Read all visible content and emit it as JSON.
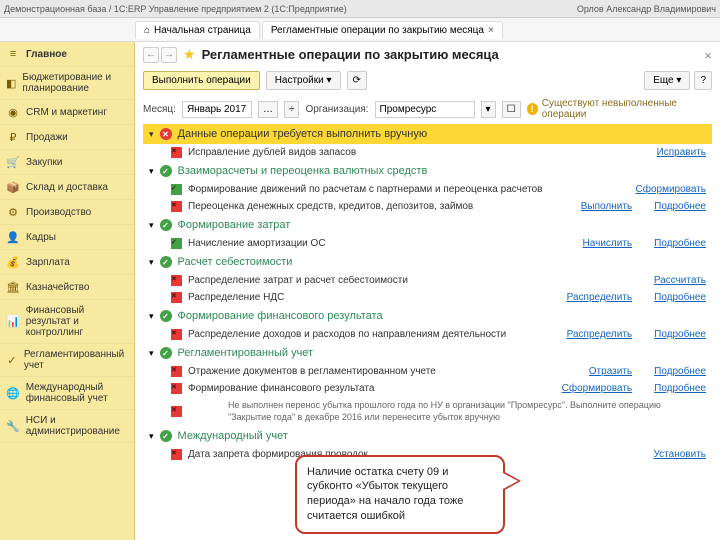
{
  "topbar": {
    "left": "Демонстрационная база / 1С:ERP Управление предприятием 2 (1С:Предприятие)",
    "right": "Орлов Александр Владимирович"
  },
  "tabs": {
    "home": "Начальная страница",
    "current": "Регламентные операции по закрытию месяца"
  },
  "sidebar": {
    "items": [
      {
        "icon": "≡",
        "label": "Главное"
      },
      {
        "icon": "◧",
        "label": "Бюджетирование и планирование"
      },
      {
        "icon": "◉",
        "label": "CRM и маркетинг"
      },
      {
        "icon": "₽",
        "label": "Продажи"
      },
      {
        "icon": "🛒",
        "label": "Закупки"
      },
      {
        "icon": "📦",
        "label": "Склад и доставка"
      },
      {
        "icon": "⚙",
        "label": "Производство"
      },
      {
        "icon": "👤",
        "label": "Кадры"
      },
      {
        "icon": "💰",
        "label": "Зарплата"
      },
      {
        "icon": "🏛",
        "label": "Казначейство"
      },
      {
        "icon": "📊",
        "label": "Финансовый результат и контроллинг"
      },
      {
        "icon": "✓",
        "label": "Регламентированный учет"
      },
      {
        "icon": "🌐",
        "label": "Международный финансовый учет"
      },
      {
        "icon": "🔧",
        "label": "НСИ и администрирование"
      }
    ]
  },
  "page": {
    "title": "Регламентные операции по закрытию месяца",
    "btn_exec": "Выполнить операции",
    "btn_settings": "Настройки",
    "btn_more": "Еще",
    "filter": {
      "month_label": "Месяц:",
      "month_value": "Январь 2017",
      "org_label": "Организация:",
      "org_value": "Промресурс"
    },
    "warning": "Существуют невыполненные операции"
  },
  "sections": [
    {
      "status": "red",
      "yellow": true,
      "title": "Данные операции требуется выполнить вручную",
      "ops": [
        {
          "status": "red",
          "label": "Исправление дублей видов запасов",
          "links": [
            "Исправить"
          ]
        }
      ]
    },
    {
      "status": "green",
      "title": "Взаиморасчеты и переоценка валютных средств",
      "ops": [
        {
          "status": "green",
          "label": "Формирование движений по расчетам с партнерами и переоценка расчетов",
          "links": [
            "Сформировать"
          ]
        },
        {
          "status": "red",
          "label": "Переоценка денежных средств, кредитов, депозитов, займов",
          "links": [
            "Выполнить",
            "Подробнее"
          ]
        }
      ]
    },
    {
      "status": "green",
      "title": "Формирование затрат",
      "ops": [
        {
          "status": "green",
          "label": "Начисление амортизации ОС",
          "links": [
            "Начислить",
            "Подробнее"
          ]
        }
      ]
    },
    {
      "status": "green",
      "title": "Расчет себестоимости",
      "ops": [
        {
          "status": "red",
          "label": "Распределение затрат и расчет себестоимости",
          "links": [
            "Рассчитать"
          ]
        },
        {
          "status": "red",
          "label": "Распределение НДС",
          "links": [
            "Распределить",
            "Подробнее"
          ]
        }
      ]
    },
    {
      "status": "green",
      "title": "Формирование финансового результата",
      "ops": [
        {
          "status": "red",
          "label": "Распределение доходов и расходов по направлениям деятельности",
          "links": [
            "Распределить",
            "Подробнее"
          ]
        }
      ]
    },
    {
      "status": "green",
      "title": "Регламентированный учет",
      "ops": [
        {
          "status": "red",
          "label": "Отражение документов в регламентированном учете",
          "links": [
            "Отразить",
            "Подробнее"
          ]
        },
        {
          "status": "red",
          "label": "Формирование финансового результата",
          "links": [
            "Сформировать",
            "Подробнее"
          ],
          "note": "Не выполнен перенос убытка прошлого года по НУ в организации \"Промресурс\". Выполните операцию \"Закрытие года\" в декабре 2016 или перенесите убыток вручную"
        }
      ]
    },
    {
      "status": "green",
      "title": "Международный учет",
      "ops": [
        {
          "status": "red",
          "label": "Дата запрета формирования проводок",
          "links": [
            "Установить"
          ]
        }
      ]
    }
  ],
  "callout": "Наличие остатка счету 09 и субконто «Убыток текущего периода» на начало года тоже считается ошибкой"
}
